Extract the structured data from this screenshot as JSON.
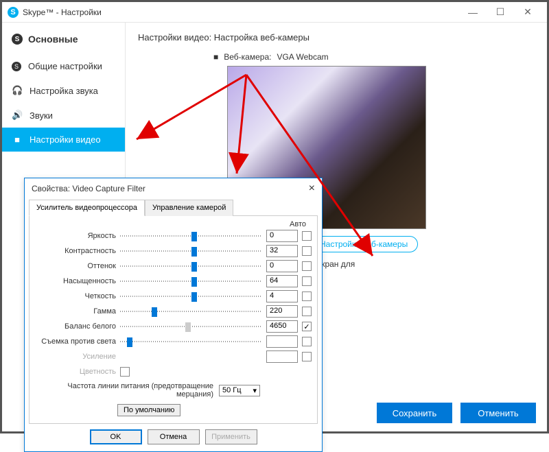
{
  "window": {
    "title": "Skype™ - Настройки",
    "logo_letter": "S"
  },
  "sidebar": {
    "header": "Основные",
    "items": [
      {
        "label": "Общие настройки",
        "icon": "S"
      },
      {
        "label": "Настройка звука",
        "icon": "🎧"
      },
      {
        "label": "Звуки",
        "icon": "🔊"
      },
      {
        "label": "Настройки видео",
        "icon": "■",
        "active": true
      }
    ]
  },
  "content": {
    "title": "Настройки видео: Настройка веб-камеры",
    "webcam_label": "Веб-камера:",
    "webcam_name": "VGA Webcam",
    "cam_settings_btn": "Настройки веб-камеры",
    "truncated": "ровать экран для"
  },
  "footer": {
    "save": "Сохранить",
    "cancel": "Отменить"
  },
  "dialog": {
    "title": "Свойства: Video Capture Filter",
    "tabs": [
      "Усилитель видеопроцессора",
      "Управление камерой"
    ],
    "auto_header": "Авто",
    "sliders": [
      {
        "label": "Яркость",
        "value": "0",
        "pos": 50,
        "auto": false
      },
      {
        "label": "Контрастность",
        "value": "32",
        "pos": 50,
        "auto": false
      },
      {
        "label": "Оттенок",
        "value": "0",
        "pos": 50,
        "auto": false
      },
      {
        "label": "Насыщенность",
        "value": "64",
        "pos": 50,
        "auto": false
      },
      {
        "label": "Четкость",
        "value": "4",
        "pos": 50,
        "auto": false
      },
      {
        "label": "Гамма",
        "value": "220",
        "pos": 22,
        "auto": false
      },
      {
        "label": "Баланс белого",
        "value": "4650",
        "pos": 46,
        "auto": true,
        "grey": true
      },
      {
        "label": "Съемка против света",
        "value": "",
        "pos": 5,
        "auto": false
      },
      {
        "label": "Усиление",
        "value": "",
        "pos": -1,
        "dim": true
      },
      {
        "label": "Цветность",
        "value": "",
        "pos": -1,
        "dim": true,
        "checkbox_only": true
      }
    ],
    "freq_label": "Частота линии питания (предотвращение мерцания)",
    "freq_value": "50 Гц",
    "default_btn": "По умолчанию",
    "ok": "OK",
    "cancel": "Отмена",
    "apply": "Применить"
  }
}
